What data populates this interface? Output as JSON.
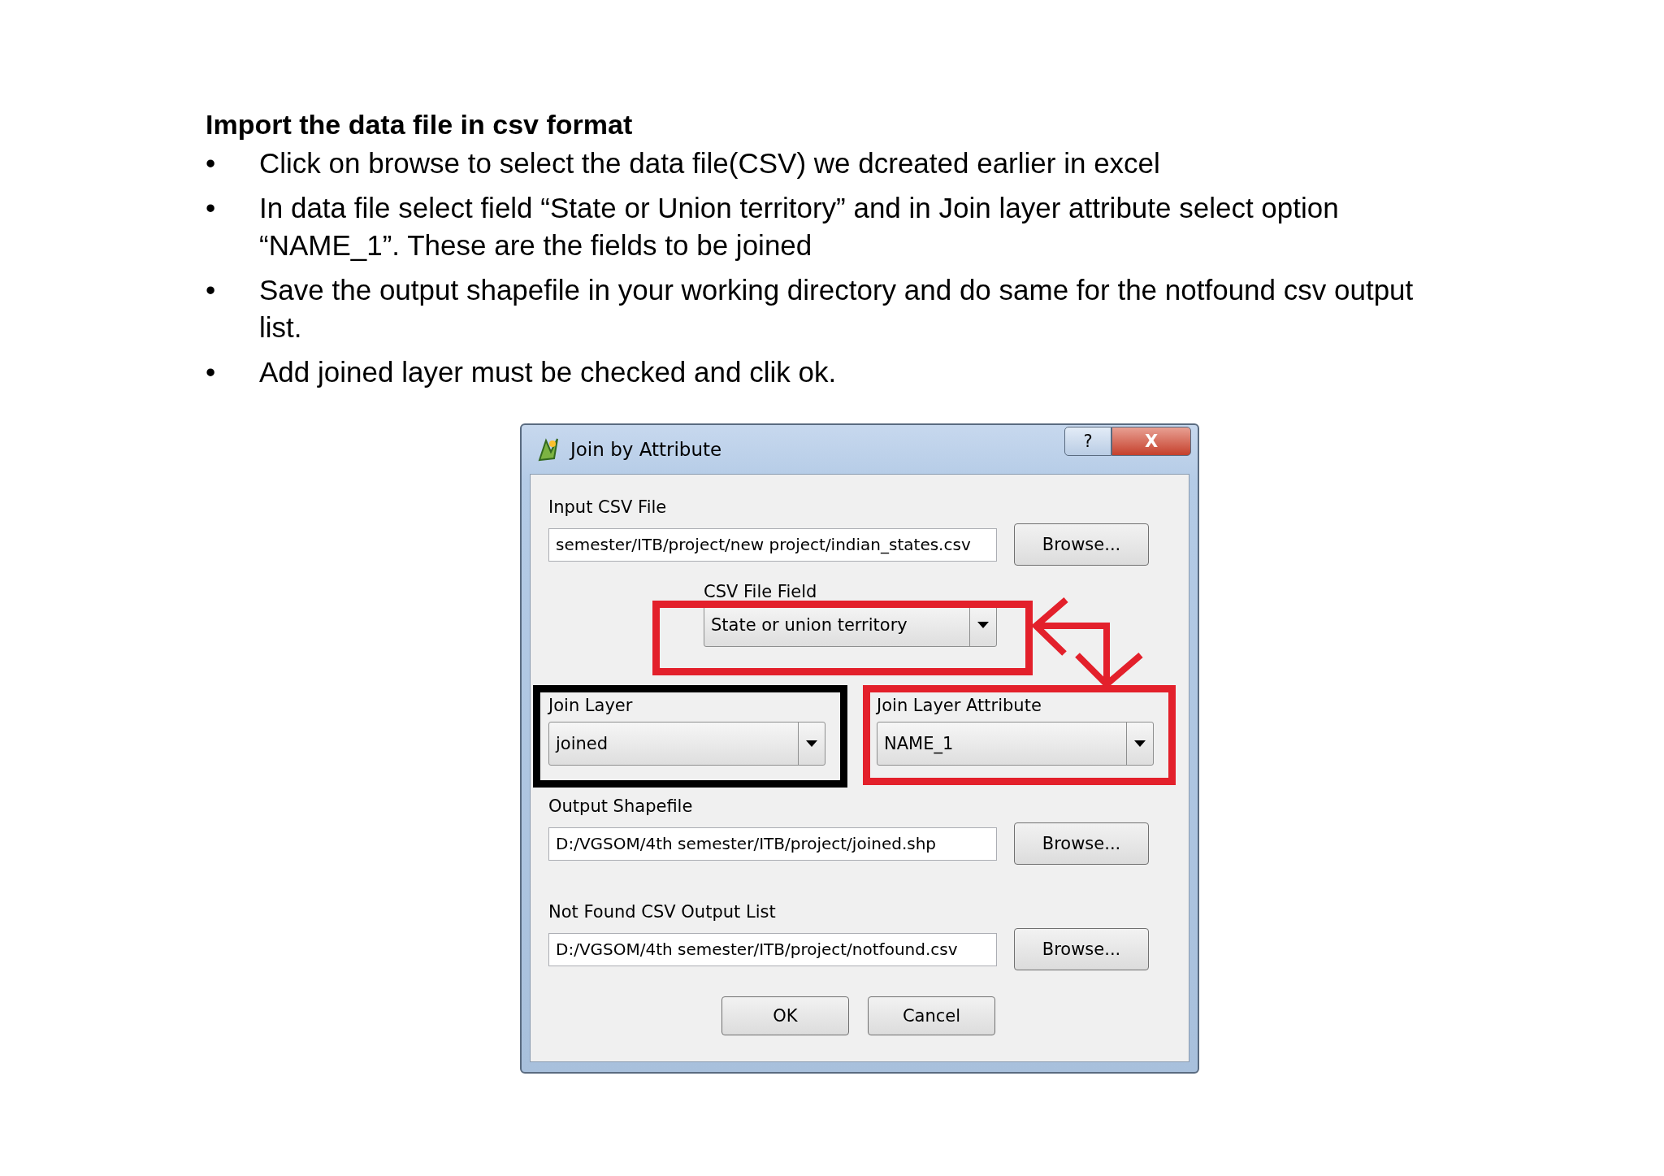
{
  "heading": "Import the data file in csv format",
  "bullets": [
    {
      "marker": "•",
      "text": "Click on browse to select the data file(CSV) we dcreated earlier in excel"
    },
    {
      "marker": "•",
      "text": "In data file select field “State or Union territory” and in Join layer attribute select option “NAME_1”. These are the fields to be joined"
    },
    {
      "marker": "•",
      "text": "Save the output shapefile in your working directory and do same for the notfound csv output list."
    },
    {
      "marker": "•",
      "text": "Add joined layer must be checked and clik ok."
    }
  ],
  "dialog": {
    "title": "Join by Attribute",
    "help": "?",
    "close": "X",
    "input_csv": {
      "label": "Input CSV File",
      "value": "semester/ITB/project/new project/indian_states.csv",
      "button": "Browse..."
    },
    "csv_field": {
      "label": "CSV File Field",
      "value": "State or union territory"
    },
    "join_layer": {
      "label": "Join Layer",
      "value": "joined"
    },
    "join_attribute": {
      "label": "Join Layer Attribute",
      "value": "NAME_1"
    },
    "output_shapefile": {
      "label": "Output Shapefile",
      "value": "D:/VGSOM/4th semester/ITB/project/joined.shp",
      "button": "Browse..."
    },
    "not_found": {
      "label": "Not Found CSV Output List",
      "value": "D:/VGSOM/4th semester/ITB/project/notfound.csv",
      "button": "Browse..."
    },
    "buttons": [
      "OK",
      "Cancel"
    ]
  },
  "highlights": [
    {
      "kind": "box",
      "color": "#e3202b"
    },
    {
      "kind": "box",
      "color": "#000000"
    },
    {
      "kind": "box",
      "color": "#e3202b"
    },
    {
      "kind": "arrow",
      "color": "#e3202b"
    }
  ]
}
